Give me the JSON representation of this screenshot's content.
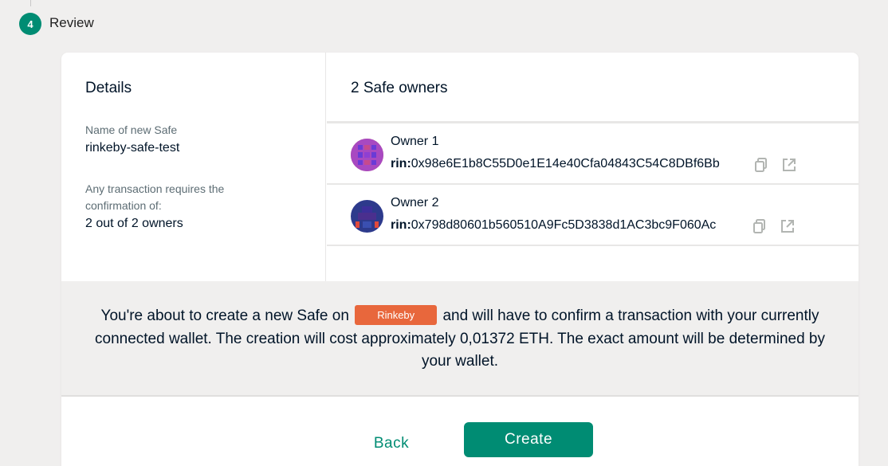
{
  "stepper": {
    "number": "4",
    "label": "Review"
  },
  "details": {
    "title": "Details",
    "name_label": "Name of new Safe",
    "name_value": "rinkeby-safe-test",
    "confirm_label": "Any transaction requires the confirmation of:",
    "confirm_value": "2 out of 2 owners"
  },
  "owners": {
    "title": "2 Safe owners",
    "list": [
      {
        "name": "Owner 1",
        "prefix": "rin:",
        "address": "0x98e6E1b8C55D0e1E14e40Cfa04843C54C8DBf6Bb"
      },
      {
        "name": "Owner 2",
        "prefix": "rin:",
        "address": "0x798d80601b560510A9Fc5D3838d1AC3bc9F060Ac"
      }
    ]
  },
  "notice": {
    "before": "You're about to create a new Safe on",
    "network": "Rinkeby",
    "after": "and will have to confirm a transaction with your currently connected wallet. The creation will cost approximately 0,01372 ETH. The exact amount will be determined by your wallet."
  },
  "actions": {
    "back_label": "Back",
    "create_label": "Create"
  },
  "colors": {
    "accent": "#008c73",
    "network_badge": "#e8673c",
    "background": "#f0efee"
  },
  "icons": {
    "copy": "copy-icon",
    "external": "external-link-icon"
  }
}
